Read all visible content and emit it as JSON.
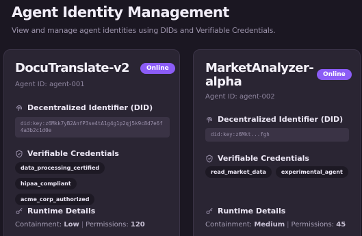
{
  "header": {
    "title": "Agent Identity Management",
    "subtitle": "View and manage agent identities using DIDs and Verifiable Credentials."
  },
  "agents": [
    {
      "name": "DocuTranslate-v2",
      "status": "Online",
      "agent_id": "Agent ID: agent-001",
      "did_title": "Decentralized Identifier (DID)",
      "did": "did:key:z6Mkk7yB2AnfP3se4tA1g4g1p2qj5k9c8d7e6f4a3b2c1d0e",
      "vc_title": "Verifiable Credentials",
      "credentials": [
        "data_processing_certified",
        "hipaa_compliant",
        "acme_corp_authorized"
      ],
      "runtime_title": "Runtime Details",
      "containment_label": "Containment:",
      "containment_value": "Low",
      "permissions_label": "Permissions:",
      "permissions_value": "120"
    },
    {
      "name": "MarketAnalyzer-alpha",
      "status": "Online",
      "agent_id": "Agent ID: agent-002",
      "did_title": "Decentralized Identifier (DID)",
      "did": "did:key:z6Mkt...fgh",
      "vc_title": "Verifiable Credentials",
      "credentials": [
        "read_market_data",
        "experimental_agent"
      ],
      "runtime_title": "Runtime Details",
      "containment_label": "Containment:",
      "containment_value": "Medium",
      "permissions_label": "Permissions:",
      "permissions_value": "45"
    }
  ],
  "colors": {
    "accent": "#8b5cf6",
    "background": "#1b1722",
    "card": "#2a2533"
  },
  "icons": {
    "did": "fingerprint-icon",
    "vc": "shield-check-icon",
    "runtime": "key-icon"
  }
}
